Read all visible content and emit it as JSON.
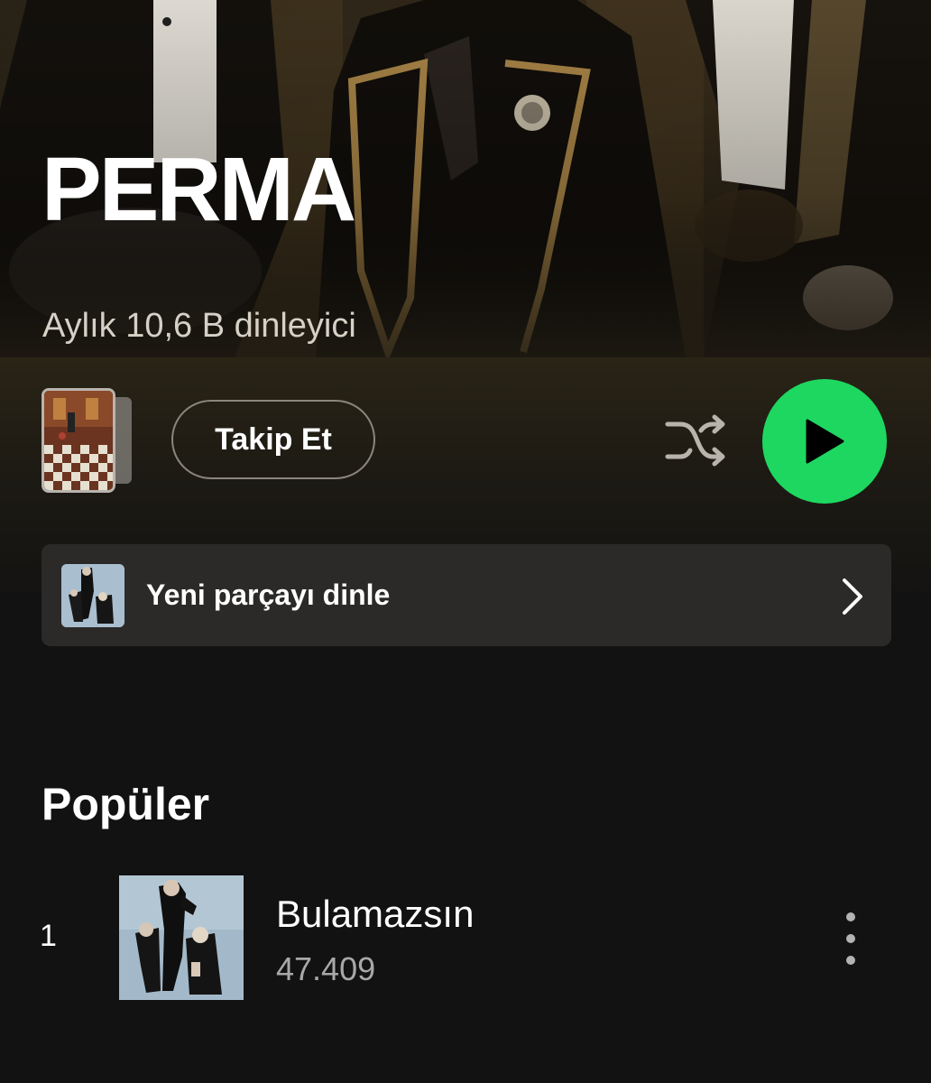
{
  "artist": {
    "name": "PERMA",
    "monthly_listeners": "Aylık 10,6 B dinleyici"
  },
  "controls": {
    "follow_label": "Takip Et",
    "shuffle_icon": "shuffle-icon",
    "play_icon": "play-icon",
    "play_color": "#1ed760"
  },
  "new_track": {
    "label": "Yeni parçayı dinle",
    "chevron_icon": "chevron-right-icon"
  },
  "popular": {
    "title": "Popüler",
    "tracks": [
      {
        "number": "1",
        "title": "Bulamazsın",
        "plays": "47.409"
      }
    ]
  },
  "colors": {
    "background": "#121212",
    "accent_green": "#1ed760",
    "secondary_text": "#a8a8a8"
  }
}
